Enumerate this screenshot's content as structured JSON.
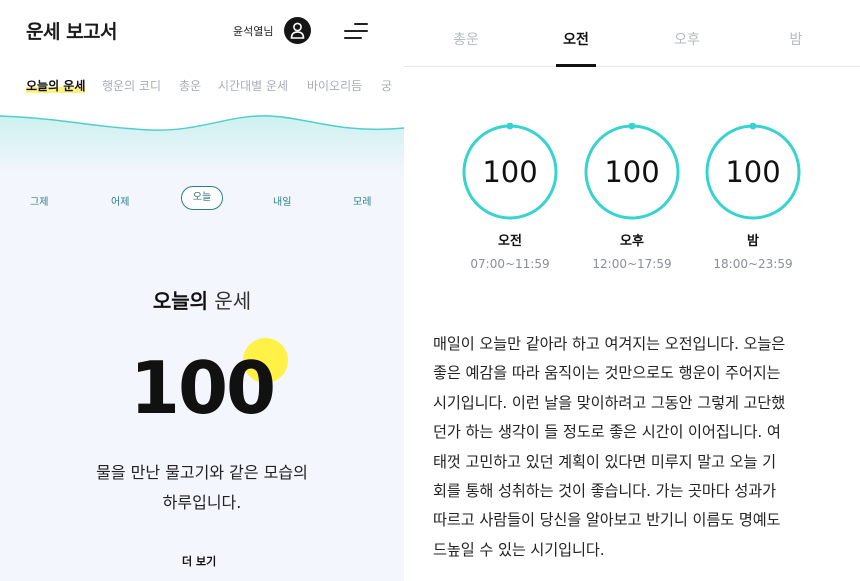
{
  "app": {
    "title": "운세 보고서",
    "user_name": "윤석열님"
  },
  "icons": {
    "avatar": "user-avatar-icon",
    "menu": "hamburger-menu-icon"
  },
  "colors": {
    "accent_teal": "#36d3cf",
    "highlight_yellow": "#fff146",
    "day_tab": "#2c7e86"
  },
  "nav_tabs": [
    {
      "label": "오늘의 운세",
      "active": true
    },
    {
      "label": "행운의 코디",
      "active": false
    },
    {
      "label": "총운",
      "active": false
    },
    {
      "label": "시간대별 운세",
      "active": false
    },
    {
      "label": "바이오리듬",
      "active": false
    },
    {
      "label": "궁",
      "active": false
    }
  ],
  "days": [
    {
      "label": "그제",
      "active": false
    },
    {
      "label": "어제",
      "active": false
    },
    {
      "label": "오늘",
      "active": true
    },
    {
      "label": "내일",
      "active": false
    },
    {
      "label": "모레",
      "active": false
    }
  ],
  "today": {
    "title_bold": "오늘의",
    "title_light": "운세",
    "score": "100",
    "summary_line1": "물을 만난 물고기와 같은 모습의",
    "summary_line2": "하루입니다.",
    "more_label": "더 보기"
  },
  "time_tabs": [
    {
      "label": "총운",
      "active": false
    },
    {
      "label": "오전",
      "active": true
    },
    {
      "label": "오후",
      "active": false
    },
    {
      "label": "밤",
      "active": false
    }
  ],
  "gauges": [
    {
      "score": "100",
      "label": "오전",
      "time": "07:00~11:59",
      "level": 1.0
    },
    {
      "score": "100",
      "label": "오후",
      "time": "12:00~17:59",
      "level": 1.0
    },
    {
      "score": "100",
      "label": "밤",
      "time": "18:00~23:59",
      "level": 1.0
    }
  ],
  "description_lines": [
    "매일이 오늘만 같아라 하고 여겨지는 오전입니다. 오늘은",
    "좋은 예감을 따라 움직이는 것만으로도 행운이 주어지는",
    "시기입니다. 이런 날을 맞이하려고 그동안 그렇게 고단했",
    "던가 하는 생각이 들 정도로 좋은 시간이 이어집니다. 여",
    "태껏 고민하고 있던 계획이 있다면 미루지 말고 오늘 기",
    "회를 통해 성취하는 것이 좋습니다. 가는 곳마다 성과가",
    "따르고 사람들이 당신을 알아보고 반기니 이름도 명예도",
    "드높일 수 있는 시기입니다."
  ]
}
